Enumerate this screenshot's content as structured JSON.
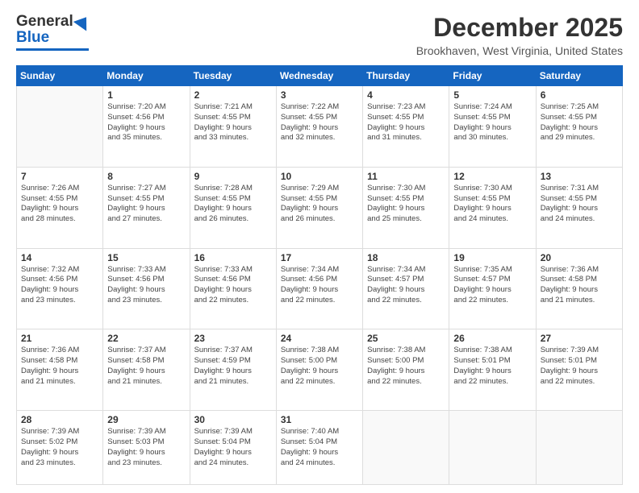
{
  "logo": {
    "general": "General",
    "blue": "Blue"
  },
  "header": {
    "title": "December 2025",
    "subtitle": "Brookhaven, West Virginia, United States"
  },
  "days_of_week": [
    "Sunday",
    "Monday",
    "Tuesday",
    "Wednesday",
    "Thursday",
    "Friday",
    "Saturday"
  ],
  "weeks": [
    [
      {
        "day": "",
        "info": ""
      },
      {
        "day": "1",
        "info": "Sunrise: 7:20 AM\nSunset: 4:56 PM\nDaylight: 9 hours\nand 35 minutes."
      },
      {
        "day": "2",
        "info": "Sunrise: 7:21 AM\nSunset: 4:55 PM\nDaylight: 9 hours\nand 33 minutes."
      },
      {
        "day": "3",
        "info": "Sunrise: 7:22 AM\nSunset: 4:55 PM\nDaylight: 9 hours\nand 32 minutes."
      },
      {
        "day": "4",
        "info": "Sunrise: 7:23 AM\nSunset: 4:55 PM\nDaylight: 9 hours\nand 31 minutes."
      },
      {
        "day": "5",
        "info": "Sunrise: 7:24 AM\nSunset: 4:55 PM\nDaylight: 9 hours\nand 30 minutes."
      },
      {
        "day": "6",
        "info": "Sunrise: 7:25 AM\nSunset: 4:55 PM\nDaylight: 9 hours\nand 29 minutes."
      }
    ],
    [
      {
        "day": "7",
        "info": "Sunrise: 7:26 AM\nSunset: 4:55 PM\nDaylight: 9 hours\nand 28 minutes."
      },
      {
        "day": "8",
        "info": "Sunrise: 7:27 AM\nSunset: 4:55 PM\nDaylight: 9 hours\nand 27 minutes."
      },
      {
        "day": "9",
        "info": "Sunrise: 7:28 AM\nSunset: 4:55 PM\nDaylight: 9 hours\nand 26 minutes."
      },
      {
        "day": "10",
        "info": "Sunrise: 7:29 AM\nSunset: 4:55 PM\nDaylight: 9 hours\nand 26 minutes."
      },
      {
        "day": "11",
        "info": "Sunrise: 7:30 AM\nSunset: 4:55 PM\nDaylight: 9 hours\nand 25 minutes."
      },
      {
        "day": "12",
        "info": "Sunrise: 7:30 AM\nSunset: 4:55 PM\nDaylight: 9 hours\nand 24 minutes."
      },
      {
        "day": "13",
        "info": "Sunrise: 7:31 AM\nSunset: 4:55 PM\nDaylight: 9 hours\nand 24 minutes."
      }
    ],
    [
      {
        "day": "14",
        "info": "Sunrise: 7:32 AM\nSunset: 4:56 PM\nDaylight: 9 hours\nand 23 minutes."
      },
      {
        "day": "15",
        "info": "Sunrise: 7:33 AM\nSunset: 4:56 PM\nDaylight: 9 hours\nand 23 minutes."
      },
      {
        "day": "16",
        "info": "Sunrise: 7:33 AM\nSunset: 4:56 PM\nDaylight: 9 hours\nand 22 minutes."
      },
      {
        "day": "17",
        "info": "Sunrise: 7:34 AM\nSunset: 4:56 PM\nDaylight: 9 hours\nand 22 minutes."
      },
      {
        "day": "18",
        "info": "Sunrise: 7:34 AM\nSunset: 4:57 PM\nDaylight: 9 hours\nand 22 minutes."
      },
      {
        "day": "19",
        "info": "Sunrise: 7:35 AM\nSunset: 4:57 PM\nDaylight: 9 hours\nand 22 minutes."
      },
      {
        "day": "20",
        "info": "Sunrise: 7:36 AM\nSunset: 4:58 PM\nDaylight: 9 hours\nand 21 minutes."
      }
    ],
    [
      {
        "day": "21",
        "info": "Sunrise: 7:36 AM\nSunset: 4:58 PM\nDaylight: 9 hours\nand 21 minutes."
      },
      {
        "day": "22",
        "info": "Sunrise: 7:37 AM\nSunset: 4:58 PM\nDaylight: 9 hours\nand 21 minutes."
      },
      {
        "day": "23",
        "info": "Sunrise: 7:37 AM\nSunset: 4:59 PM\nDaylight: 9 hours\nand 21 minutes."
      },
      {
        "day": "24",
        "info": "Sunrise: 7:38 AM\nSunset: 5:00 PM\nDaylight: 9 hours\nand 22 minutes."
      },
      {
        "day": "25",
        "info": "Sunrise: 7:38 AM\nSunset: 5:00 PM\nDaylight: 9 hours\nand 22 minutes."
      },
      {
        "day": "26",
        "info": "Sunrise: 7:38 AM\nSunset: 5:01 PM\nDaylight: 9 hours\nand 22 minutes."
      },
      {
        "day": "27",
        "info": "Sunrise: 7:39 AM\nSunset: 5:01 PM\nDaylight: 9 hours\nand 22 minutes."
      }
    ],
    [
      {
        "day": "28",
        "info": "Sunrise: 7:39 AM\nSunset: 5:02 PM\nDaylight: 9 hours\nand 23 minutes."
      },
      {
        "day": "29",
        "info": "Sunrise: 7:39 AM\nSunset: 5:03 PM\nDaylight: 9 hours\nand 23 minutes."
      },
      {
        "day": "30",
        "info": "Sunrise: 7:39 AM\nSunset: 5:04 PM\nDaylight: 9 hours\nand 24 minutes."
      },
      {
        "day": "31",
        "info": "Sunrise: 7:40 AM\nSunset: 5:04 PM\nDaylight: 9 hours\nand 24 minutes."
      },
      {
        "day": "",
        "info": ""
      },
      {
        "day": "",
        "info": ""
      },
      {
        "day": "",
        "info": ""
      }
    ]
  ]
}
